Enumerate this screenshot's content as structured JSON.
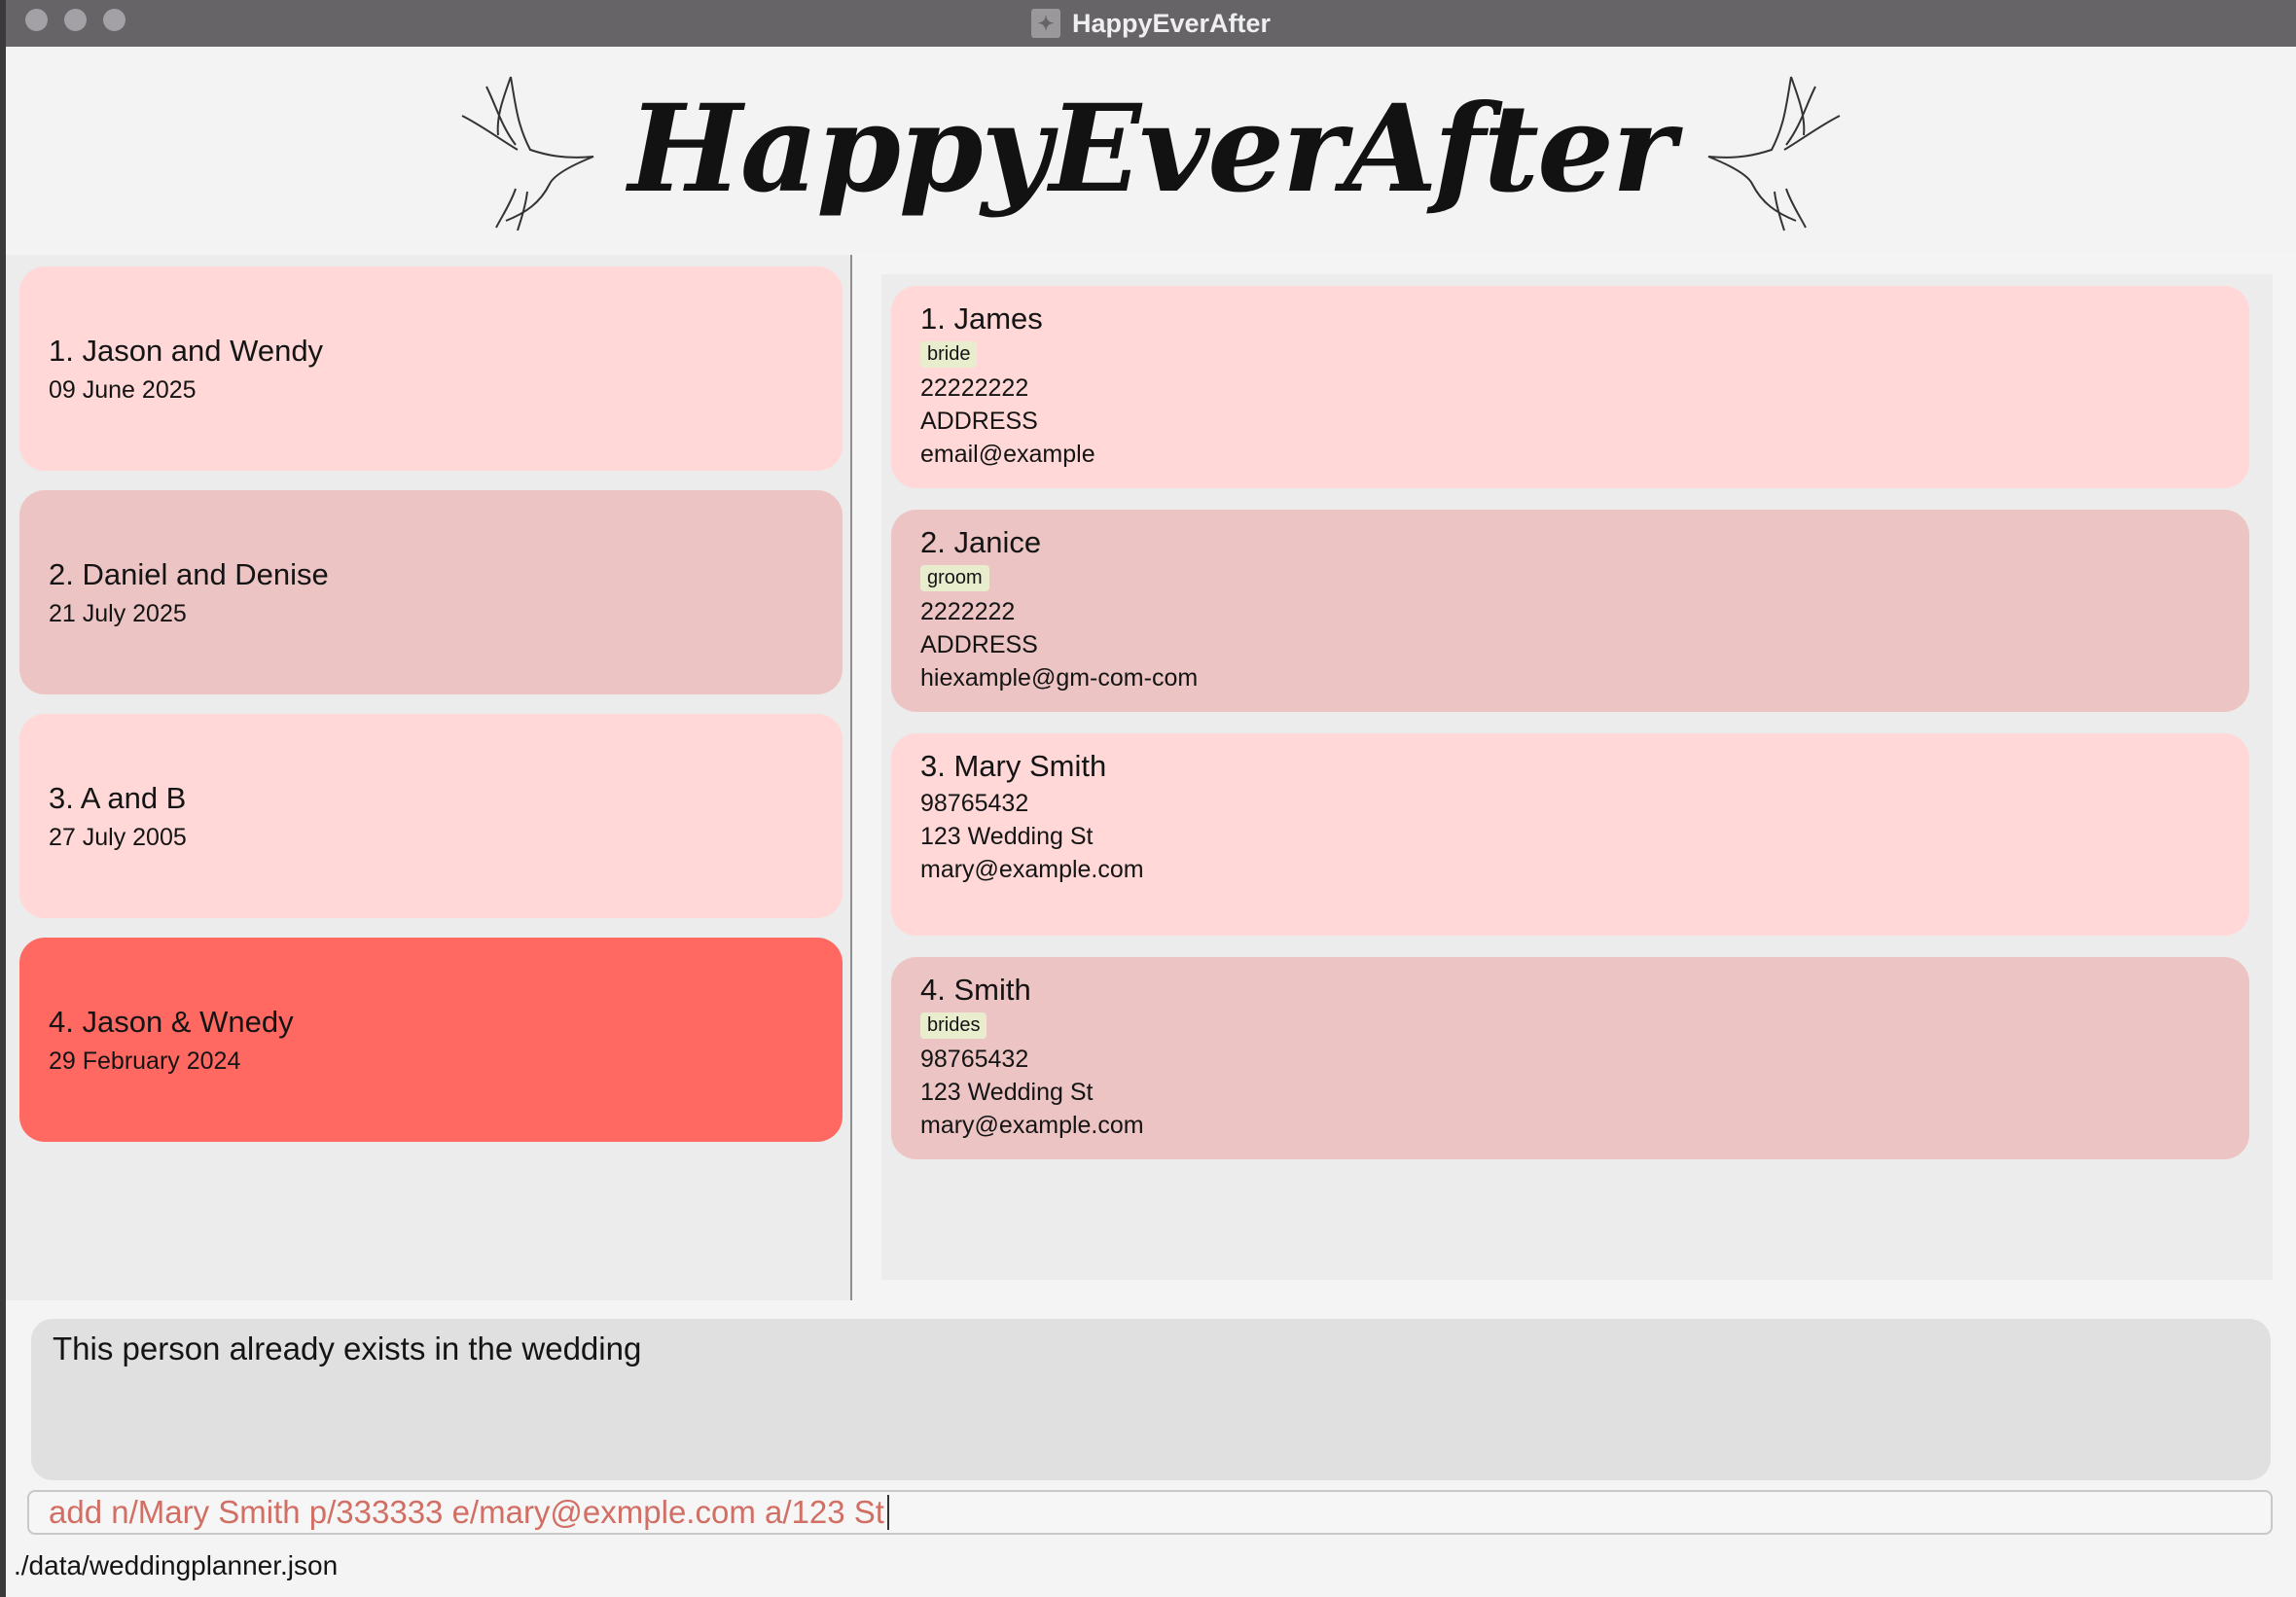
{
  "window": {
    "title": "HappyEverAfter"
  },
  "banner": {
    "title": "HappyEverAfter"
  },
  "weddings": [
    {
      "title": "1. Jason and Wendy",
      "date": "09 June 2025"
    },
    {
      "title": "2. Daniel and Denise",
      "date": "21 July 2025"
    },
    {
      "title": "3. A and B",
      "date": "27 July 2005"
    },
    {
      "title": "4. Jason & Wnedy",
      "date": "29 February 2024"
    }
  ],
  "persons": [
    {
      "name": "1. James",
      "tag": "bride",
      "phone": "22222222",
      "address": "ADDRESS",
      "email": "email@example"
    },
    {
      "name": "2. Janice",
      "tag": "groom",
      "phone": "2222222",
      "address": "ADDRESS",
      "email": "hiexample@gm-com-com"
    },
    {
      "name": "3. Mary Smith",
      "tag": "",
      "phone": "98765432",
      "address": "123 Wedding St",
      "email": "mary@example.com"
    },
    {
      "name": "4. Smith",
      "tag": "brides",
      "phone": "98765432",
      "address": "123 Wedding St",
      "email": "mary@example.com"
    }
  ],
  "result": {
    "message": "This person already exists in the wedding"
  },
  "command": {
    "value": "add n/Mary Smith p/333333 e/mary@exmple.com a/123 St"
  },
  "status": {
    "path": "./data/weddingplanner.json"
  },
  "colors": {
    "card_light": "#ffd8d7",
    "card_mid": "#edc4c4",
    "card_selected": "#ff6962",
    "tag_bg": "#e8edce",
    "command_text": "#d16f65"
  },
  "icons": [
    "dove-icon",
    "app-icon"
  ]
}
